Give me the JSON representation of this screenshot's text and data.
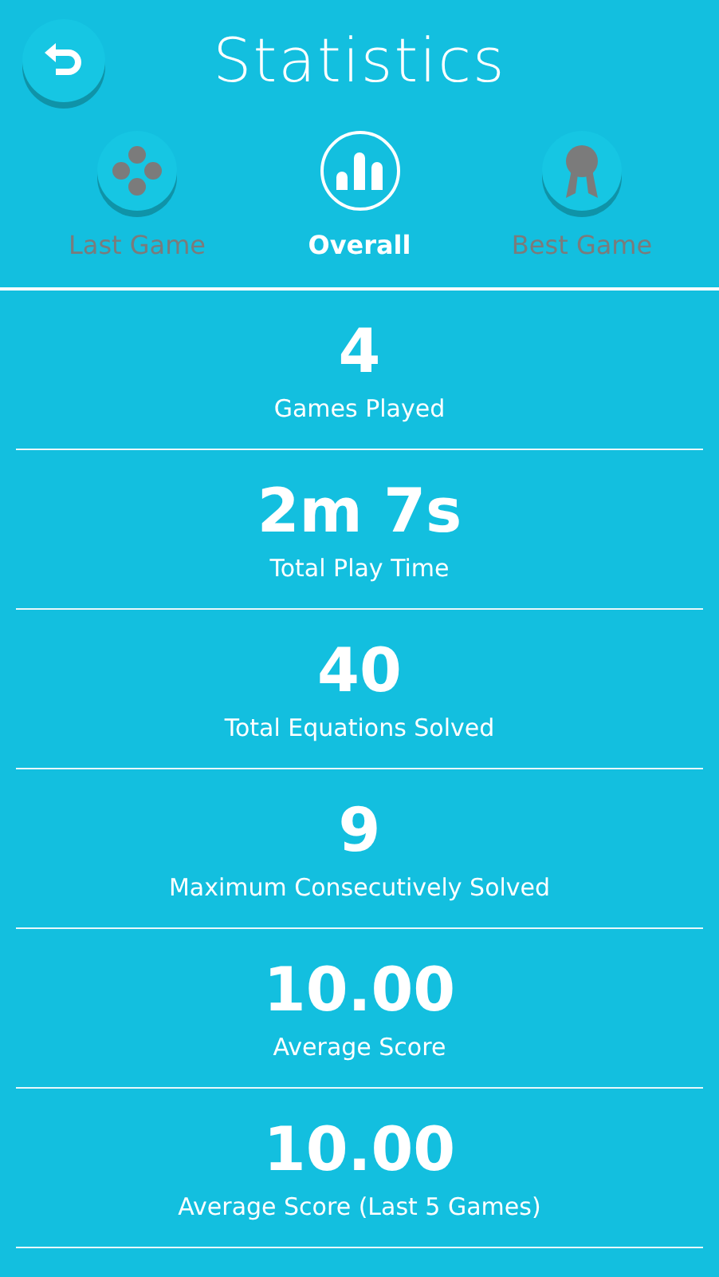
{
  "header": {
    "title": "Statistics"
  },
  "tabs": [
    {
      "label": "Last Game",
      "kind": "game",
      "selected": false
    },
    {
      "label": "Overall",
      "kind": "overall",
      "selected": true
    },
    {
      "label": "Best Game",
      "kind": "best",
      "selected": false
    }
  ],
  "stats": [
    {
      "value": "4",
      "label": "Games Played"
    },
    {
      "value": "2m 7s",
      "label": "Total Play Time"
    },
    {
      "value": "40",
      "label": "Total Equations Solved"
    },
    {
      "value": "9",
      "label": "Maximum Consecutively Solved"
    },
    {
      "value": "10.00",
      "label": "Average Score"
    },
    {
      "value": "10.00",
      "label": "Average Score (Last 5 Games)"
    }
  ]
}
